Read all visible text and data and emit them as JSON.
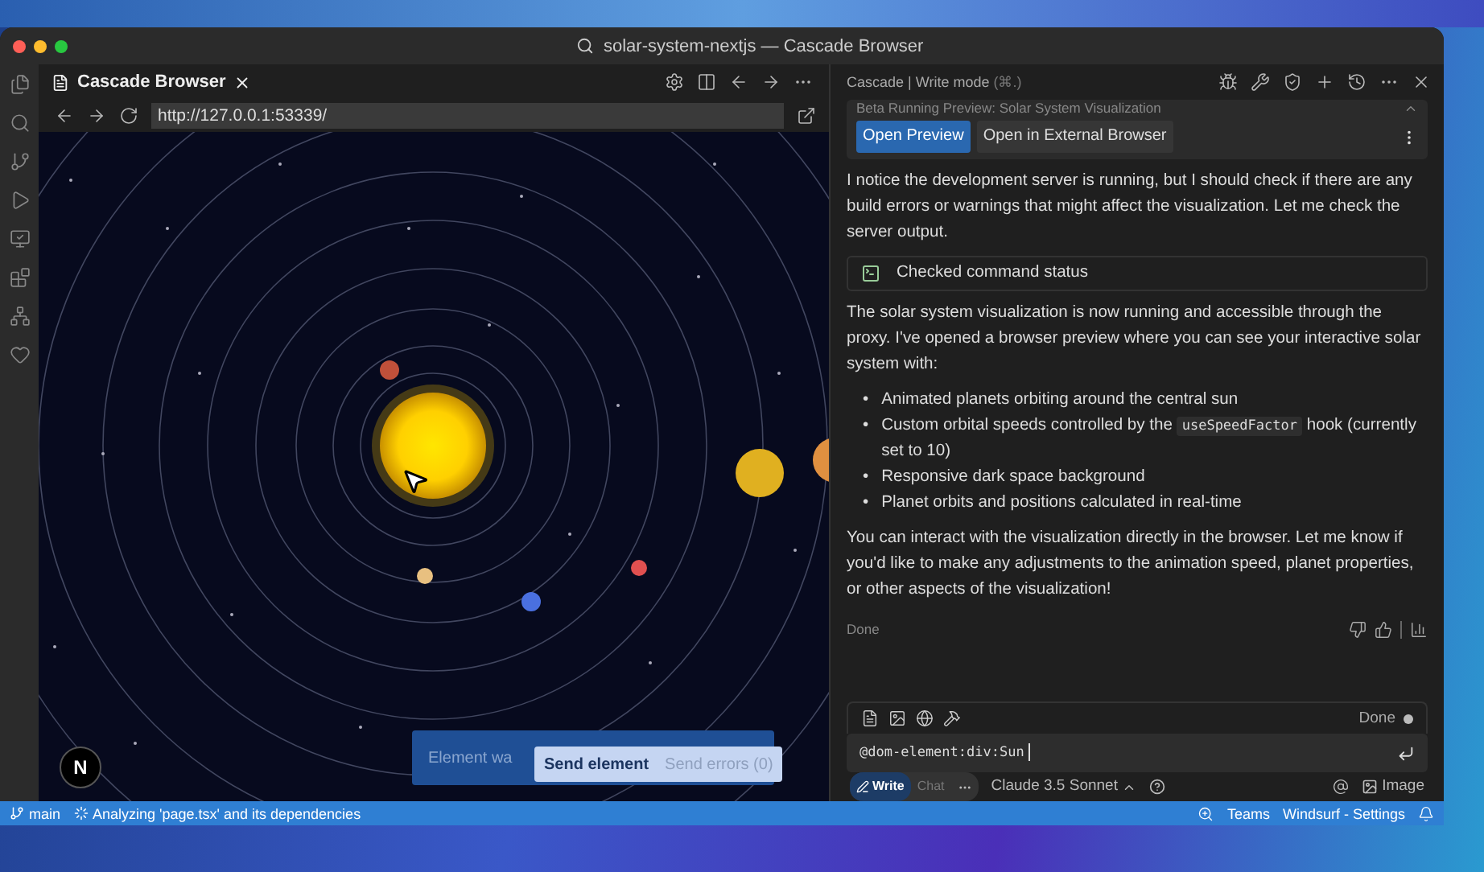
{
  "window": {
    "title": "solar-system-nextjs — Cascade Browser"
  },
  "browser": {
    "tab_title": "Cascade Browser",
    "url": "http://127.0.0.1:53339/",
    "framework_badge": "N",
    "toast": {
      "text": "Element wa",
      "send_element": "Send element",
      "send_errors": "Send errors (0)"
    }
  },
  "chat": {
    "header_title": "Cascade | Write mode",
    "shortcut": "(⌘.)",
    "banner_title": "Beta  Running Preview:  Solar System Visualization",
    "banner_buttons": [
      {
        "label": "Open Preview",
        "primary": true
      },
      {
        "label": "Open in External Browser",
        "primary": false
      }
    ],
    "intro": "I notice the development server is running, but I should check if there are any build errors or warnings that might affect the visualization. Let me check the server output.",
    "tool_call": "Checked command status",
    "message": "The solar system visualization is now running and accessible through the proxy. I've opened a browser preview where you can see your interactive solar system with:",
    "bullet_marker": "•",
    "bullets": [
      [
        {
          "kind": "text",
          "text": "Animated planets orbiting around the central sun"
        }
      ],
      [
        {
          "kind": "text",
          "text": "Custom orbital speeds controlled by the "
        },
        {
          "kind": "code",
          "text": "useSpeedFactor"
        },
        {
          "kind": "text",
          "text": " hook (currently set to 10)"
        }
      ],
      [
        {
          "kind": "text",
          "text": "Responsive dark space background"
        }
      ],
      [
        {
          "kind": "text",
          "text": "Planet orbits and positions calculated in real-time"
        }
      ]
    ],
    "closing": "You can interact with the visualization directly in the browser. Let me know if you'd like to make any adjustments to the animation speed, planet properties, or other aspects of the visualization!",
    "status": "Done",
    "composer": {
      "status": "Done",
      "value": "@dom-element:div:Sun",
      "modes": [
        {
          "label": "Write",
          "selected": true
        },
        {
          "label": "Chat",
          "selected": false
        }
      ],
      "model": "Claude 3.5 Sonnet",
      "image_label": "Image"
    }
  },
  "status_bar": {
    "branch": "main",
    "task": "Analyzing 'page.tsx' and its dependencies",
    "right_items": [
      "Teams",
      "Windsurf - Settings"
    ]
  }
}
